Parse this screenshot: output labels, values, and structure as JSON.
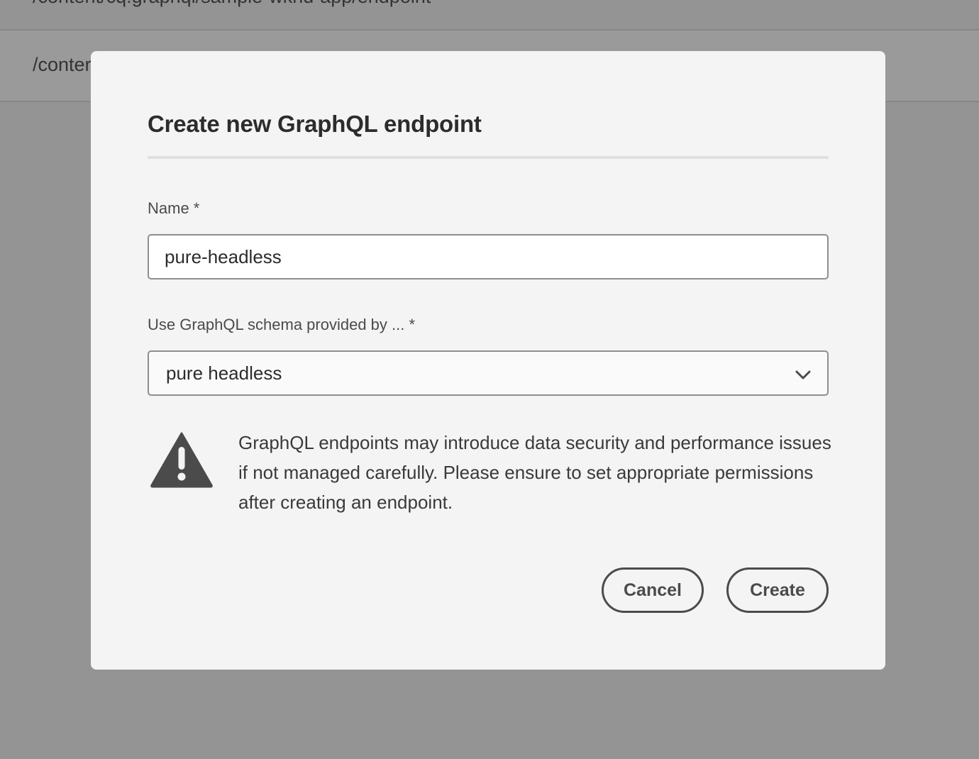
{
  "background": {
    "rows": [
      {
        "path": "/content/cq:graphql/sample-wknd-app/endpoint"
      },
      {
        "path": "/conter"
      }
    ]
  },
  "dialog": {
    "title": "Create new GraphQL endpoint",
    "name_field": {
      "label": "Name *",
      "value": "pure-headless"
    },
    "schema_field": {
      "label": "Use GraphQL schema provided by ... *",
      "selected": "pure headless",
      "icon": "chevron-down-icon"
    },
    "warning": {
      "icon": "alert-triangle-icon",
      "text": "GraphQL endpoints may introduce data security and performance issues if not managed carefully. Please ensure to set appropriate permissions after creating an endpoint."
    },
    "buttons": {
      "cancel_label": "Cancel",
      "create_label": "Create"
    }
  },
  "colors": {
    "overlay": "#949494",
    "dialog_background": "#f4f4f4",
    "button_border": "#4b4b4b",
    "warning_icon": "#4b4b4b"
  }
}
